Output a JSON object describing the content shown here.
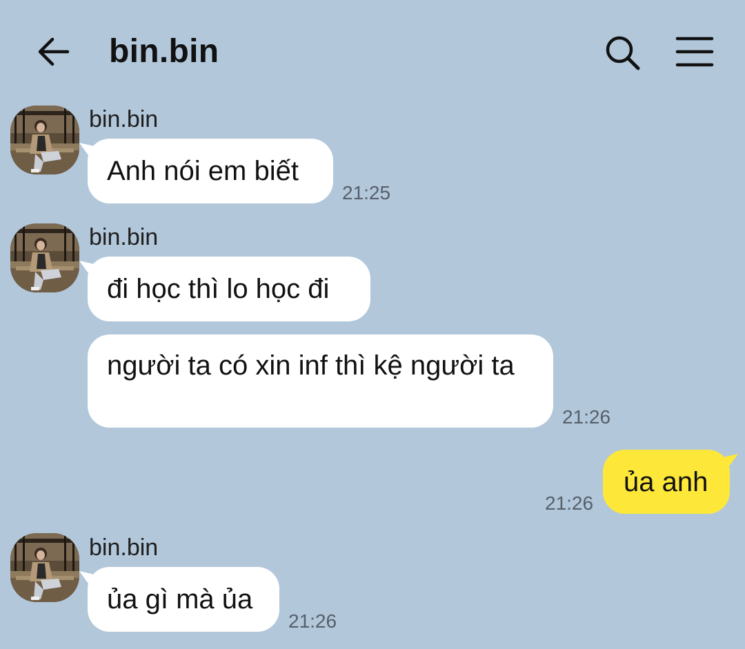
{
  "header": {
    "title": "bin.bin"
  },
  "icons": {
    "back": "arrow-left",
    "search": "magnifier",
    "menu": "hamburger"
  },
  "colors": {
    "background": "#b2c7da",
    "incoming_bubble": "#ffffff",
    "outgoing_bubble": "#fde83a",
    "timestamp": "#56606b"
  },
  "messages": [
    {
      "sender": "bin.bin",
      "text": "Anh nói em biết",
      "time": "21:25"
    },
    {
      "sender": "bin.bin",
      "text": "đi học thì lo học đi",
      "time": ""
    },
    {
      "sender": "",
      "text": "người ta có xin inf thì kệ người ta",
      "time": "21:26"
    },
    {
      "sender": "me",
      "text": "ủa anh",
      "time": "21:26"
    },
    {
      "sender": "bin.bin",
      "text": "ủa gì mà ủa",
      "time": "21:26"
    }
  ]
}
